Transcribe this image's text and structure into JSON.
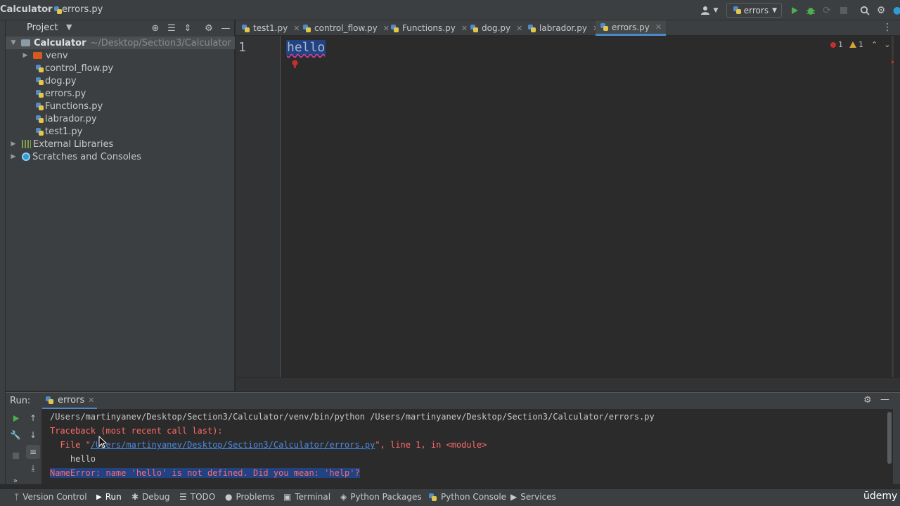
{
  "titlebar": {
    "project": "Calculator",
    "separator": "›",
    "file": "errors.py",
    "run_config": "errors"
  },
  "project_panel": {
    "title": "Project",
    "tree": [
      {
        "label": "Calculator",
        "path": "~/Desktop/Section3/Calculator",
        "level": 0,
        "kind": "folder",
        "expanded": true,
        "selected": true
      },
      {
        "label": "venv",
        "level": 1,
        "kind": "venv",
        "expanded": false
      },
      {
        "label": "control_flow.py",
        "level": 1,
        "kind": "py"
      },
      {
        "label": "dog.py",
        "level": 1,
        "kind": "py"
      },
      {
        "label": "errors.py",
        "level": 1,
        "kind": "py"
      },
      {
        "label": "Functions.py",
        "level": 1,
        "kind": "py"
      },
      {
        "label": "labrador.py",
        "level": 1,
        "kind": "py"
      },
      {
        "label": "test1.py",
        "level": 1,
        "kind": "py"
      },
      {
        "label": "External Libraries",
        "level": 0,
        "kind": "lib",
        "expanded": false
      },
      {
        "label": "Scratches and Consoles",
        "level": 0,
        "kind": "scratch",
        "expanded": false
      }
    ]
  },
  "editor": {
    "tabs": [
      {
        "label": "test1.py"
      },
      {
        "label": "control_flow.py"
      },
      {
        "label": "Functions.py"
      },
      {
        "label": "dog.py"
      },
      {
        "label": "labrador.py"
      },
      {
        "label": "errors.py",
        "active": true
      }
    ],
    "line_number": "1",
    "code": "hello",
    "errors_count": "1",
    "warnings_count": "1"
  },
  "run_panel": {
    "label": "Run:",
    "tab": "errors",
    "console": {
      "command": "/Users/martinyanev/Desktop/Section3/Calculator/venv/bin/python /Users/martinyanev/Desktop/Section3/Calculator/errors.py",
      "traceback": "Traceback (most recent call last):",
      "file_prefix": "  File \"",
      "file_link": "/Users/martinyanev/Desktop/Section3/Calculator/errors.py",
      "file_suffix": "\", line 1, in <module>",
      "code_line": "    hello",
      "error": "NameError: name 'hello' is not defined. Did you mean: 'help'?"
    }
  },
  "statusbar": {
    "items": [
      {
        "label": "Version Control",
        "icon": "branch-icon"
      },
      {
        "label": "Run",
        "icon": "play-icon",
        "active": true
      },
      {
        "label": "Debug",
        "icon": "bug-icon"
      },
      {
        "label": "TODO",
        "icon": "list-icon"
      },
      {
        "label": "Problems",
        "icon": "info-icon"
      },
      {
        "label": "Terminal",
        "icon": "terminal-icon"
      },
      {
        "label": "Python Packages",
        "icon": "layers-icon"
      },
      {
        "label": "Python Console",
        "icon": "python-icon"
      },
      {
        "label": "Services",
        "icon": "services-icon"
      }
    ],
    "watermark": "ūdemy"
  },
  "colors": {
    "accent": "#4a88c7",
    "error": "#ff6b68",
    "run_green": "#4caf50"
  }
}
